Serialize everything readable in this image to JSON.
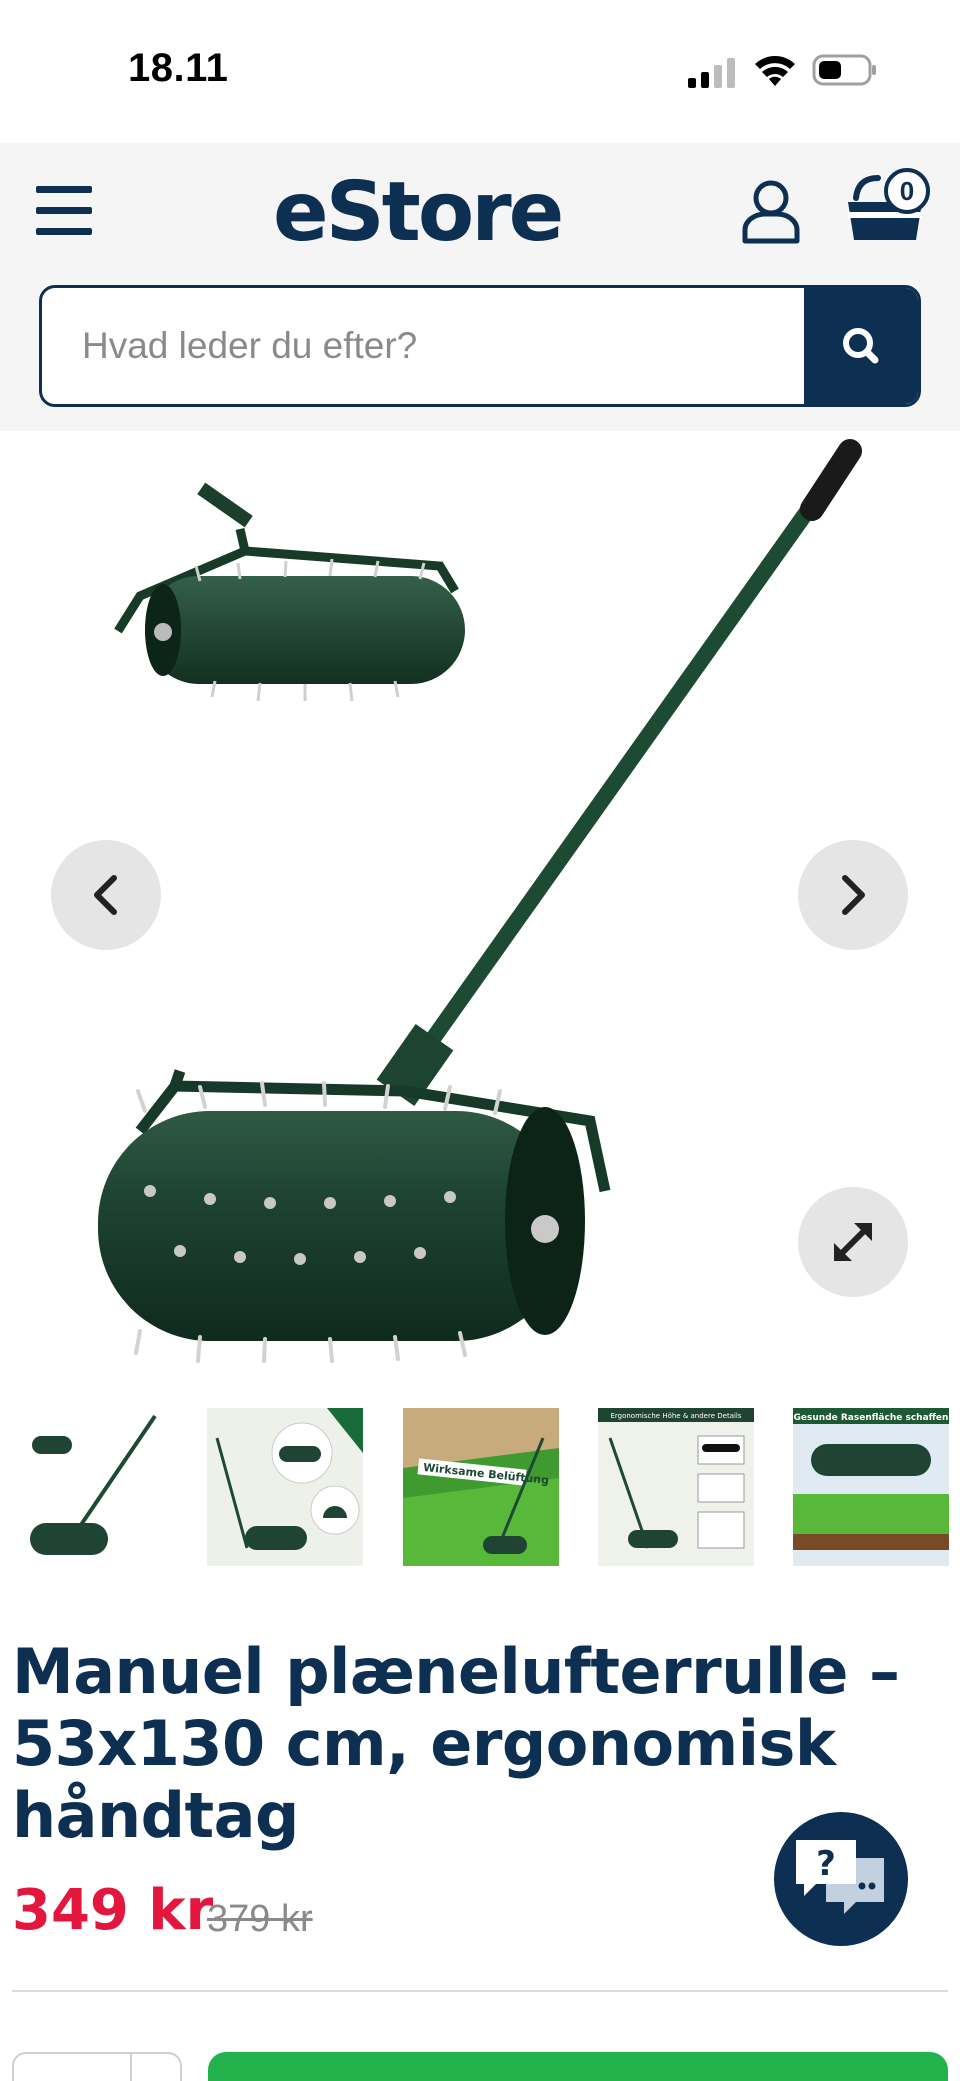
{
  "status_bar": {
    "time": "18.11"
  },
  "header": {
    "logo": "eStore",
    "cart_count": "0"
  },
  "search": {
    "placeholder": "Hvad leder du efter?"
  },
  "product": {
    "title": "Manuel plænelufterrulle – 53x130 cm, ergonomisk håndtag",
    "price": "349 kr",
    "old_price": "379 kr",
    "gallery": {
      "thumbnails": [
        {
          "label": ""
        },
        {
          "label": ""
        },
        {
          "label": "Wirksame Belüftung"
        },
        {
          "label": "Ergonomische Höhe & andere Details"
        },
        {
          "label": "Gesunde Rasenfläche schaffen"
        }
      ]
    }
  },
  "chat": {
    "label": "?"
  },
  "colors": {
    "brand": "#0d2f52",
    "price": "#e3173e",
    "cta": "#22b24c"
  }
}
